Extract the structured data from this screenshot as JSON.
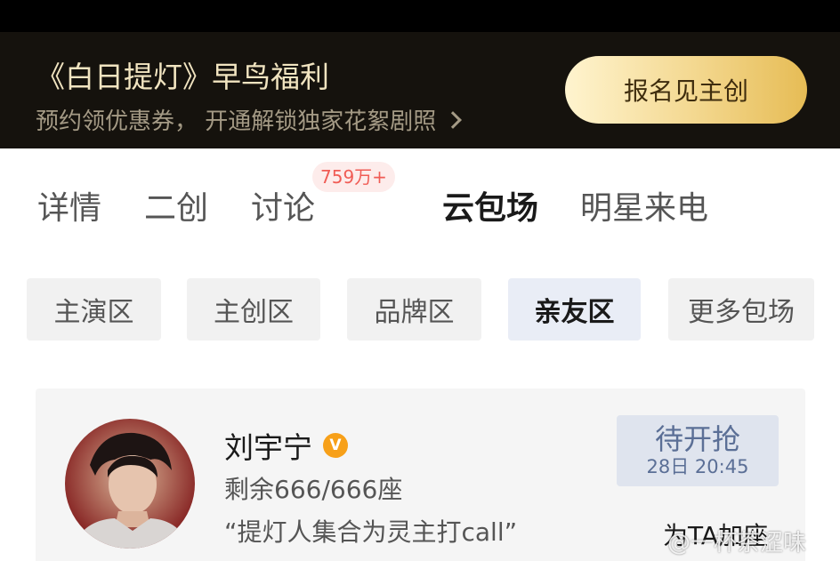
{
  "banner": {
    "title": "《白日提灯》早鸟福利",
    "subtitle": "预约领优惠券， 开通解锁独家花絮剧照",
    "cta_label": "报名见主创"
  },
  "tabs": [
    {
      "label": "详情"
    },
    {
      "label": "二创"
    },
    {
      "label": "讨论",
      "badge": "759万+"
    },
    {
      "label": "云包场",
      "active": true
    },
    {
      "label": "明星来电"
    }
  ],
  "zones": [
    {
      "label": "主演区"
    },
    {
      "label": "主创区"
    },
    {
      "label": "品牌区"
    },
    {
      "label": "亲友区",
      "active": true
    },
    {
      "label": "更多包场"
    }
  ],
  "star_card": {
    "name": "刘宇宁",
    "verified_mark": "V",
    "seats": "剩余666/666座",
    "quote": "“提灯人集合为灵主打call”",
    "status_label": "待开抢",
    "status_time": "28日 20:45",
    "add_seat_label": "为TA加座"
  },
  "watermark": "@一杯茶涩味",
  "colors": {
    "banner_bg": "#15120d",
    "banner_title": "#f1e4c0",
    "cta_gold": "#f3d78e",
    "badge_red": "#f05c55",
    "verified_orange": "#f7a019",
    "status_blue": "#5b6f96"
  }
}
